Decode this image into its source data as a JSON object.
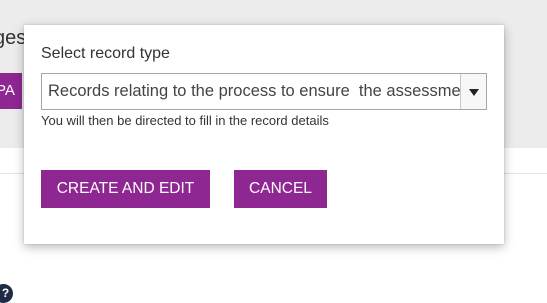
{
  "background": {
    "heading_fragment": "ges",
    "button_fragment": "PA",
    "help_icon_glyph": "?"
  },
  "dialog": {
    "title": "Select record type",
    "select": {
      "value": "Records relating to the process to ensure  the assessment"
    },
    "helper_text": "You will then be directed to fill in the record details",
    "buttons": {
      "create_label": "CREATE AND EDIT",
      "cancel_label": "CANCEL"
    }
  },
  "colors": {
    "accent": "#8e2792",
    "backdrop": "#ececec",
    "text": "#333333"
  },
  "icons": {
    "dropdown": "chevron-down-icon",
    "help": "help-icon"
  }
}
